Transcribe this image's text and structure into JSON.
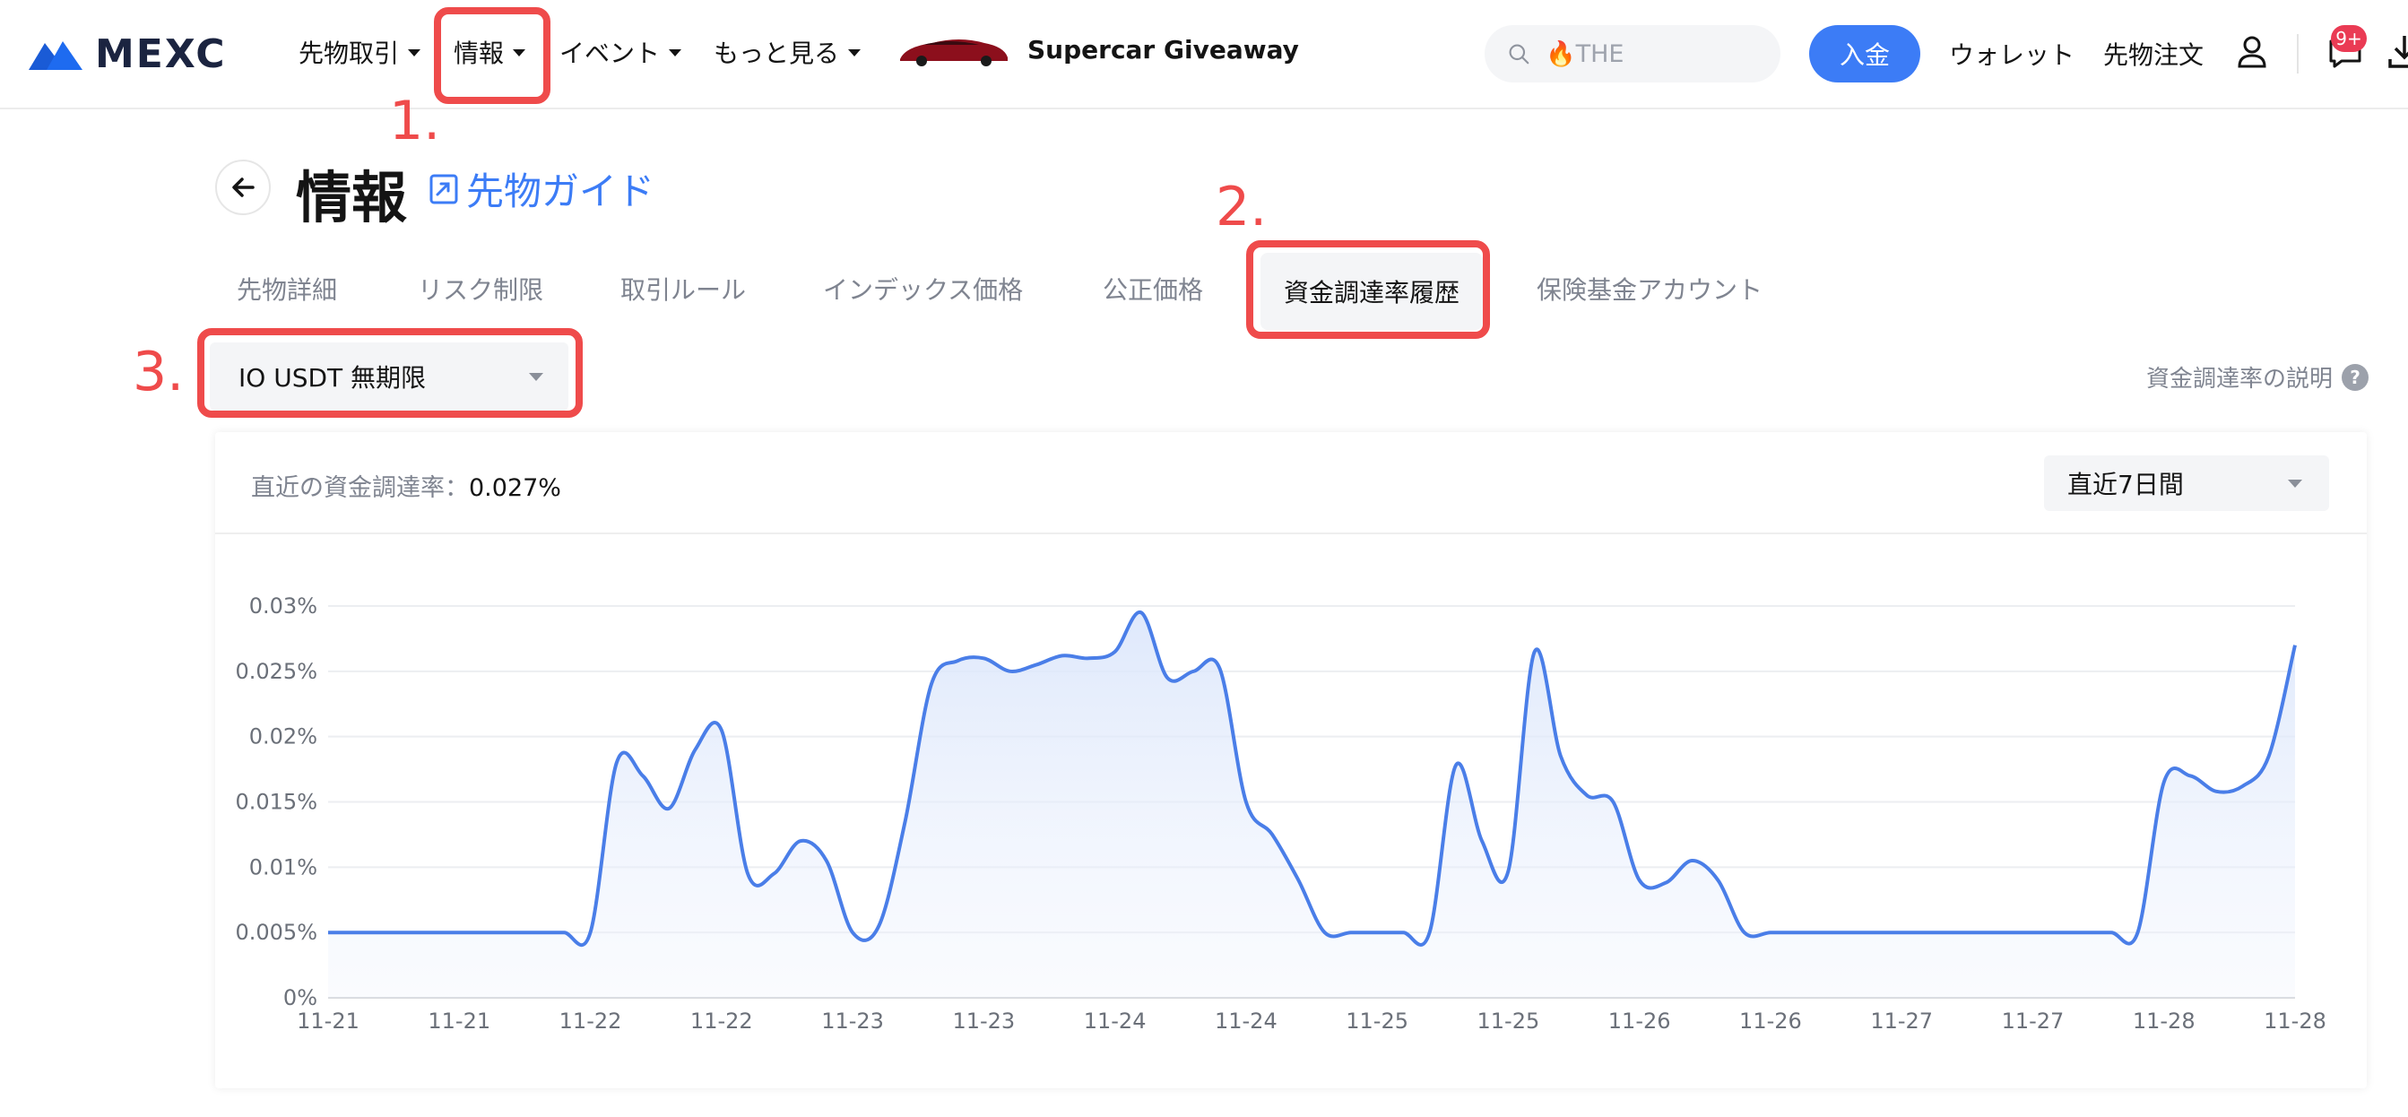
{
  "brand": {
    "name": "MEXC"
  },
  "nav": {
    "items": [
      {
        "label": "先物取引"
      },
      {
        "label": "情報"
      },
      {
        "label": "イベント"
      },
      {
        "label": "もっと見る"
      }
    ],
    "promo_label": "Supercar Giveaway",
    "search_placeholder": "🔥THE",
    "deposit_label": "入金",
    "wallet_label": "ウォレット",
    "futures_orders_label": "先物注文",
    "notification_badge": "9+",
    "icons": [
      "search-icon",
      "user-icon",
      "message-icon",
      "download-icon"
    ]
  },
  "annotations": {
    "step1": "1.",
    "step2": "2.",
    "step3": "3.",
    "color": "#ef4b4b"
  },
  "page": {
    "title": "情報",
    "guide_link": "先物ガイド"
  },
  "tabs": [
    {
      "label": "先物詳細"
    },
    {
      "label": "リスク制限"
    },
    {
      "label": "取引ルール"
    },
    {
      "label": "インデックス価格"
    },
    {
      "label": "公正価格"
    },
    {
      "label": "資金調達率履歴",
      "active": true
    },
    {
      "label": "保険基金アカウント"
    }
  ],
  "contract_select": {
    "value": "IO USDT 無期限"
  },
  "explain_link": "資金調達率の説明",
  "card": {
    "latest_label": "直近の資金調達率：",
    "latest_value": "0.027%",
    "period_value": "直近7日間"
  },
  "colors": {
    "accent": "#3c7cf6",
    "line": "#4a7ee8",
    "area": "#dbe6fb"
  },
  "chart_data": {
    "type": "area",
    "title": "",
    "xlabel": "",
    "ylabel": "",
    "ylim": [
      0,
      0.03
    ],
    "yticks": [
      "0%",
      "0.005%",
      "0.01%",
      "0.015%",
      "0.02%",
      "0.025%",
      "0.03%"
    ],
    "ytick_values": [
      0,
      0.005,
      0.01,
      0.015,
      0.02,
      0.025,
      0.03
    ],
    "xticks": [
      "11-21",
      "11-21",
      "11-22",
      "11-22",
      "11-23",
      "11-23",
      "11-24",
      "11-24",
      "11-25",
      "11-25",
      "11-26",
      "11-26",
      "11-27",
      "11-27",
      "11-28",
      "11-28"
    ],
    "grid": true,
    "legend": "none",
    "series": [
      {
        "values": [
          0.005,
          0.005,
          0.005,
          0.005,
          0.005,
          0.005,
          0.005,
          0.005,
          0.005,
          0.005,
          0.005,
          0.018,
          0.017,
          0.0145,
          0.019,
          0.0205,
          0.0095,
          0.0095,
          0.012,
          0.0105,
          0.005,
          0.0055,
          0.0135,
          0.024,
          0.0258,
          0.026,
          0.025,
          0.0255,
          0.0262,
          0.026,
          0.0265,
          0.0295,
          0.0245,
          0.025,
          0.0252,
          0.015,
          0.0125,
          0.009,
          0.005,
          0.005,
          0.005,
          0.005,
          0.005,
          0.0178,
          0.012,
          0.0097,
          0.0265,
          0.0185,
          0.0155,
          0.015,
          0.009,
          0.0088,
          0.0105,
          0.009,
          0.005,
          0.005,
          0.005,
          0.005,
          0.005,
          0.005,
          0.005,
          0.005,
          0.005,
          0.005,
          0.005,
          0.005,
          0.005,
          0.005,
          0.005,
          0.005,
          0.0165,
          0.017,
          0.0158,
          0.0162,
          0.0185,
          0.027
        ]
      }
    ]
  }
}
